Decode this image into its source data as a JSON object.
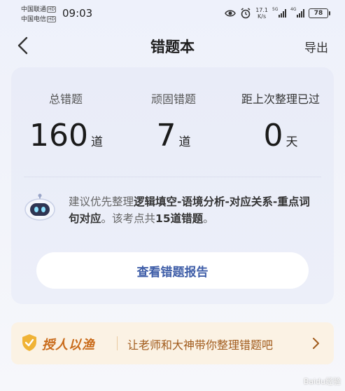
{
  "status_bar": {
    "carrier1": "中国联通",
    "carrier2": "中国电信",
    "hd": "HD",
    "time": "09:03",
    "net_speed_value": "17.1",
    "net_speed_unit": "K/s",
    "sig1_tag": "5G",
    "sig2_tag": "4G",
    "battery": "78",
    "icons": [
      "eye-icon",
      "alarm-icon",
      "signal-icon",
      "battery-icon"
    ]
  },
  "nav": {
    "title": "错题本",
    "export_label": "导出",
    "back_icon": "chevron-left-icon"
  },
  "stats": [
    {
      "label": "总错题",
      "value": "160",
      "unit": "道"
    },
    {
      "label": "顽固错题",
      "value": "7",
      "unit": "道"
    },
    {
      "label": "距上次整理已过",
      "value": "0",
      "unit": "天"
    }
  ],
  "advice": {
    "prefix": "建议优先整理",
    "topic": "逻辑填空-语境分析-对应关系-重点词句对应",
    "middle": "。该考点共",
    "count": "15道错题",
    "suffix": "。"
  },
  "report_button": "查看错题报告",
  "banner": {
    "brand": "授人以渔",
    "text": "让老师和大神带你整理错题吧",
    "accent": "#c96a19"
  },
  "watermark": "Baidu经验",
  "colors": {
    "background": "#eef1fb",
    "card": "#eaedf8",
    "button_text": "#3f5ea8",
    "banner_bg": "#fbf2e4"
  }
}
